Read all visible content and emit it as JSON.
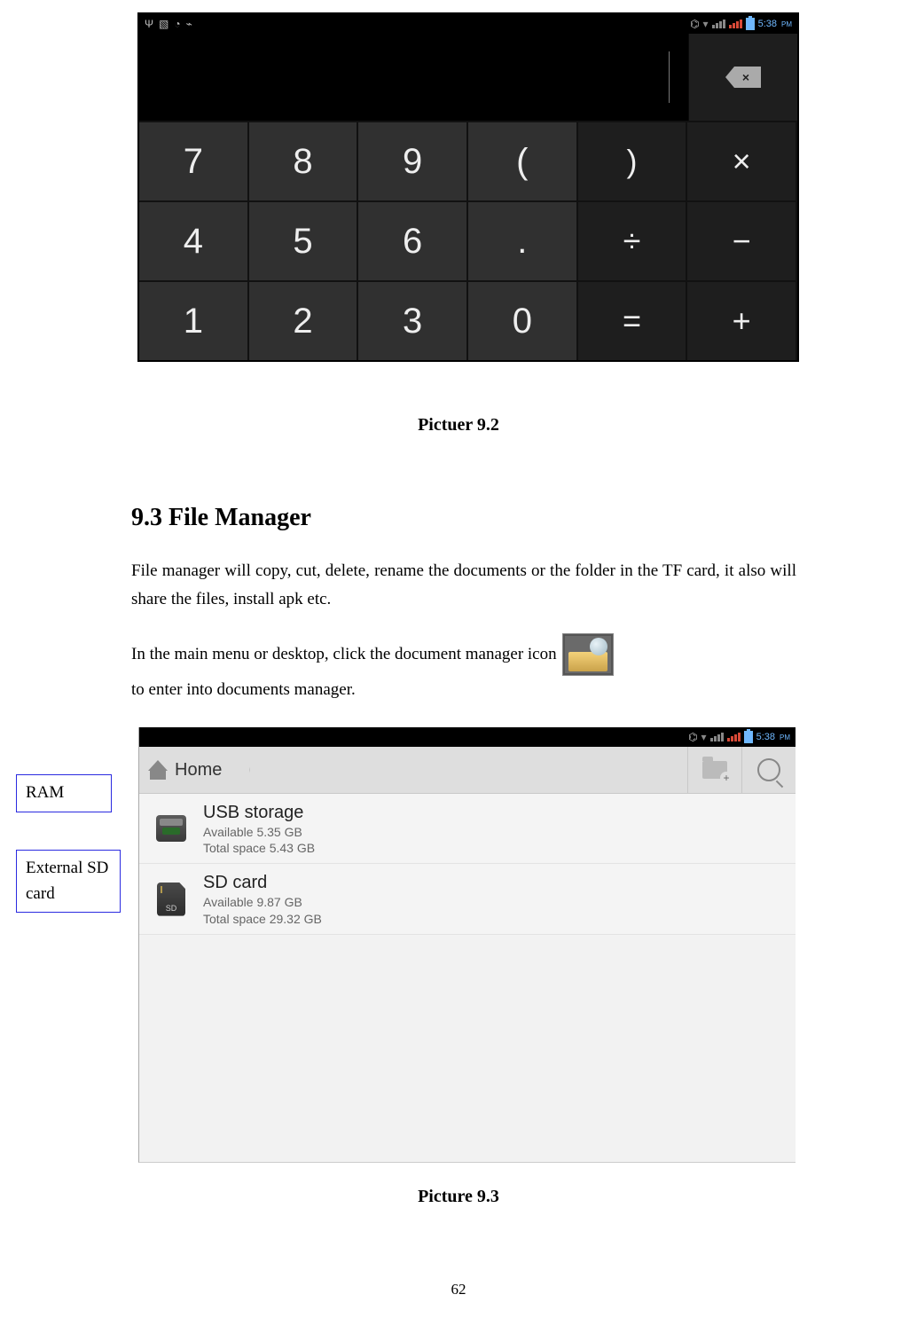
{
  "status_bar": {
    "time": "5:38",
    "ampm": "PM",
    "bt_icon": "bluetooth",
    "wifi_icon": "wifi"
  },
  "calculator": {
    "backspace_glyph": "⌫",
    "keys_row1": [
      "7",
      "8",
      "9",
      "(",
      ")",
      "×"
    ],
    "keys_row2": [
      "4",
      "5",
      "6",
      ".",
      "÷",
      "−"
    ],
    "keys_row3": [
      "1",
      "2",
      "3",
      "0",
      "=",
      "+"
    ]
  },
  "caption_92": "Pictuer 9.2",
  "section_heading": "9.3 File Manager",
  "body_p1": "File manager will copy, cut, delete, rename the documents or the folder in the TF card, it also will share the files, install apk etc.",
  "body_p2_pre": "In the main menu or desktop, click the document manager icon",
  "body_p2_post": " to enter into documents manager.",
  "file_manager": {
    "breadcrumb": "Home",
    "items": [
      {
        "title": "USB storage",
        "line1": "Available 5.35 GB",
        "line2": "Total space 5.43 GB"
      },
      {
        "title": "SD card",
        "line1": "Available 9.87 GB",
        "line2": "Total space 29.32 GB"
      }
    ]
  },
  "callouts": {
    "ram": "RAM",
    "sd": "External SD card"
  },
  "caption_93": "Picture 9.3",
  "page_number": "62"
}
